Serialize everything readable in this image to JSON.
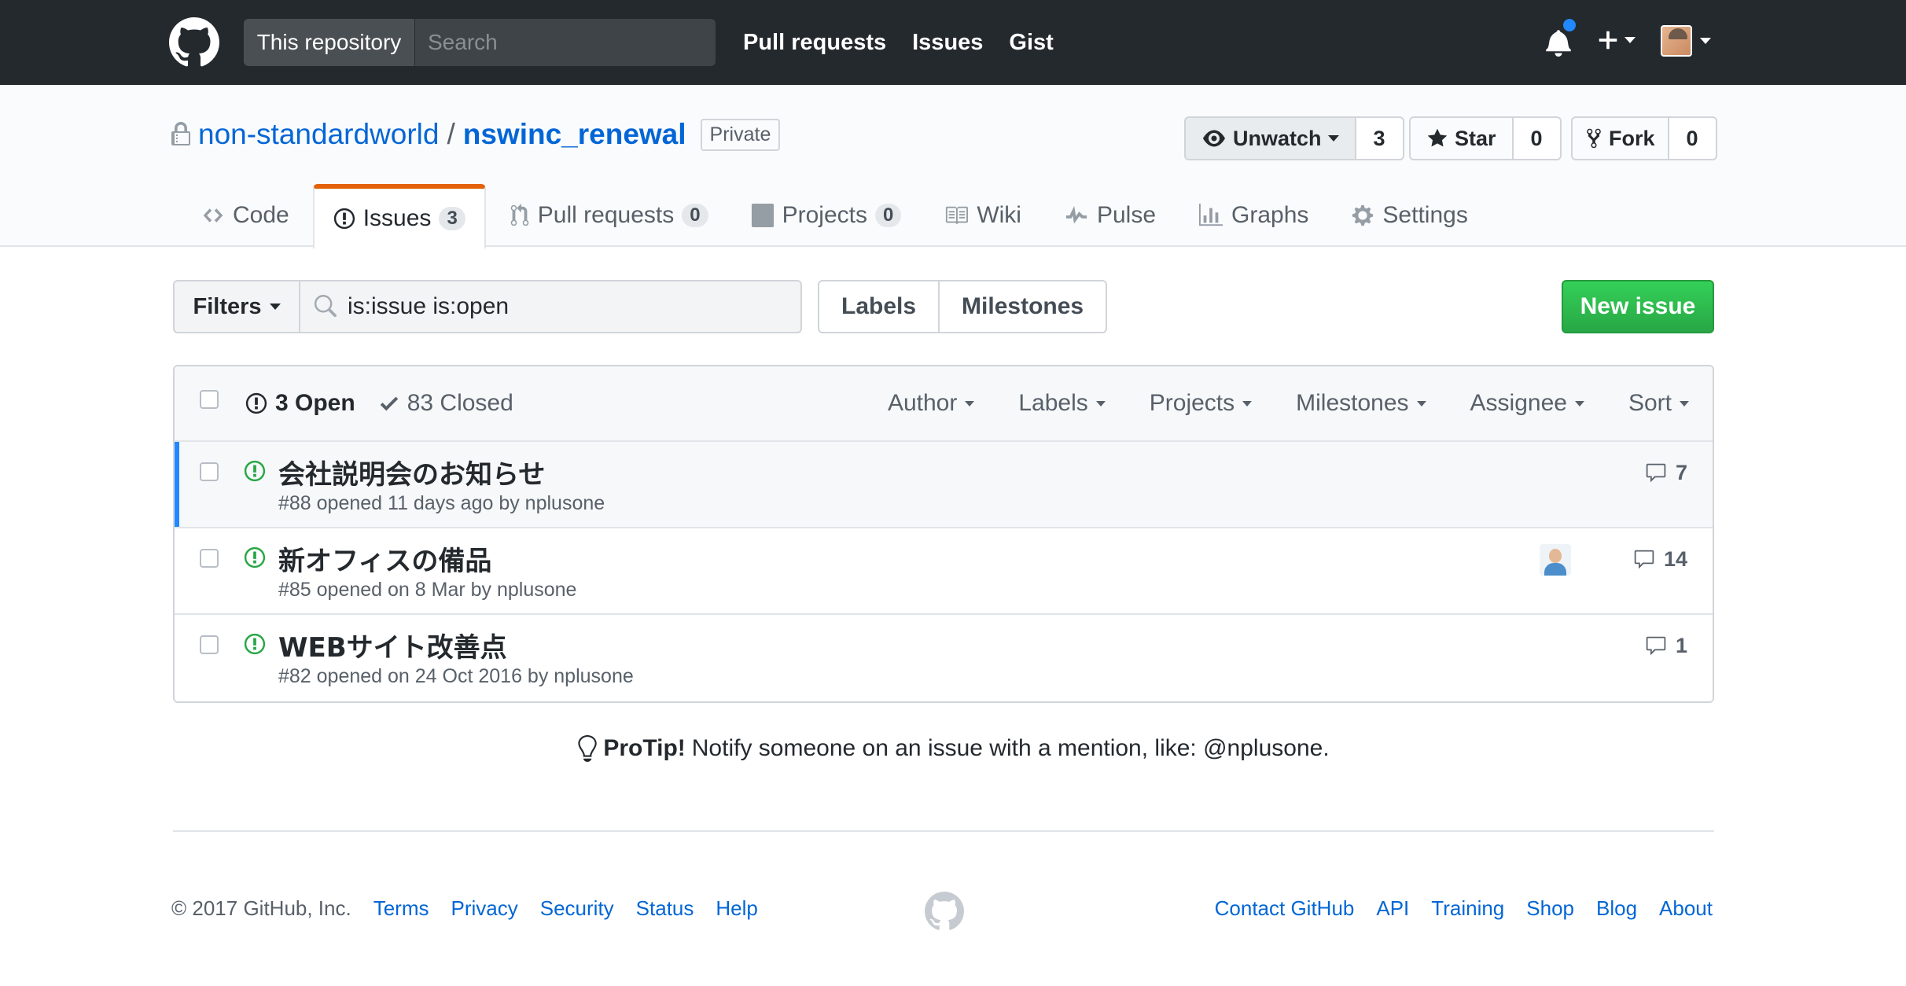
{
  "header": {
    "search_scope": "This repository",
    "search_placeholder": "Search",
    "nav": [
      "Pull requests",
      "Issues",
      "Gist"
    ]
  },
  "repo": {
    "owner": "non-standardworld",
    "separator": "/",
    "name": "nswinc_renewal",
    "visibility": "Private",
    "watch": {
      "label": "Unwatch",
      "count": "3"
    },
    "star": {
      "label": "Star",
      "count": "0"
    },
    "fork": {
      "label": "Fork",
      "count": "0"
    }
  },
  "tabs": [
    {
      "label": "Code",
      "icon": "code-icon"
    },
    {
      "label": "Issues",
      "count": "3",
      "icon": "issue-opened-icon"
    },
    {
      "label": "Pull requests",
      "count": "0",
      "icon": "git-pull-request-icon"
    },
    {
      "label": "Projects",
      "count": "0",
      "icon": "project-icon"
    },
    {
      "label": "Wiki",
      "icon": "book-icon"
    },
    {
      "label": "Pulse",
      "icon": "pulse-icon"
    },
    {
      "label": "Graphs",
      "icon": "graph-icon"
    },
    {
      "label": "Settings",
      "icon": "gear-icon"
    }
  ],
  "toolbar": {
    "filters_label": "Filters",
    "filter_query": "is:issue is:open",
    "labels_label": "Labels",
    "milestones_label": "Milestones",
    "new_issue_label": "New issue"
  },
  "list_header": {
    "open": "3 Open",
    "closed": "83 Closed",
    "filters": [
      "Author",
      "Labels",
      "Projects",
      "Milestones",
      "Assignee",
      "Sort"
    ]
  },
  "issues": [
    {
      "title": "会社説明会のお知らせ",
      "meta": "#88 opened 11 days ago by nplusone",
      "comments": "7",
      "unread": true
    },
    {
      "title": "新オフィスの備品",
      "meta": "#85 opened on 8 Mar by nplusone",
      "comments": "14",
      "has_assignee": true
    },
    {
      "title": "WEBサイト改善点",
      "meta": "#82 opened on 24 Oct 2016 by nplusone",
      "comments": "1"
    }
  ],
  "protip": {
    "label": "ProTip!",
    "text": "Notify someone on an issue with a mention, like: @nplusone."
  },
  "footer": {
    "copyright": "© 2017 GitHub, Inc.",
    "left_links": [
      "Terms",
      "Privacy",
      "Security",
      "Status",
      "Help"
    ],
    "right_links": [
      "Contact GitHub",
      "API",
      "Training",
      "Shop",
      "Blog",
      "About"
    ]
  },
  "colors": {
    "header_bg": "#24292e",
    "link": "#0366d6",
    "open_green": "#28a745",
    "tab_accent": "#e36209",
    "unread_bar": "#2188ff"
  }
}
